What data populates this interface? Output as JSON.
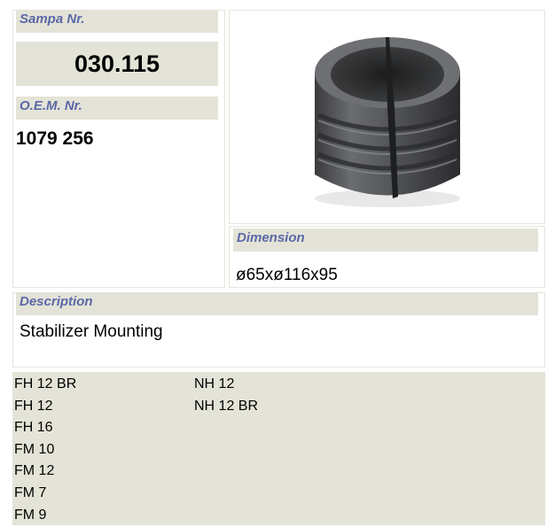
{
  "sampa": {
    "label": "Sampa Nr.",
    "value": "030.115"
  },
  "oem": {
    "label": "O.E.M. Nr.",
    "value": "1079 256"
  },
  "dimension": {
    "label": "Dimension",
    "value": "ø65xø116x95"
  },
  "description": {
    "label": "Description",
    "value": "Stabilizer Mounting"
  },
  "models": {
    "column1": [
      "FH 12 BR",
      "FH 12",
      "FH 16",
      "FM 10",
      "FM 12",
      "FM 7",
      "FM 9"
    ],
    "column2": [
      "NH 12",
      "NH 12 BR"
    ]
  },
  "colors": {
    "header_bg": "#e4e3d7",
    "header_text": "#5b68a8"
  }
}
